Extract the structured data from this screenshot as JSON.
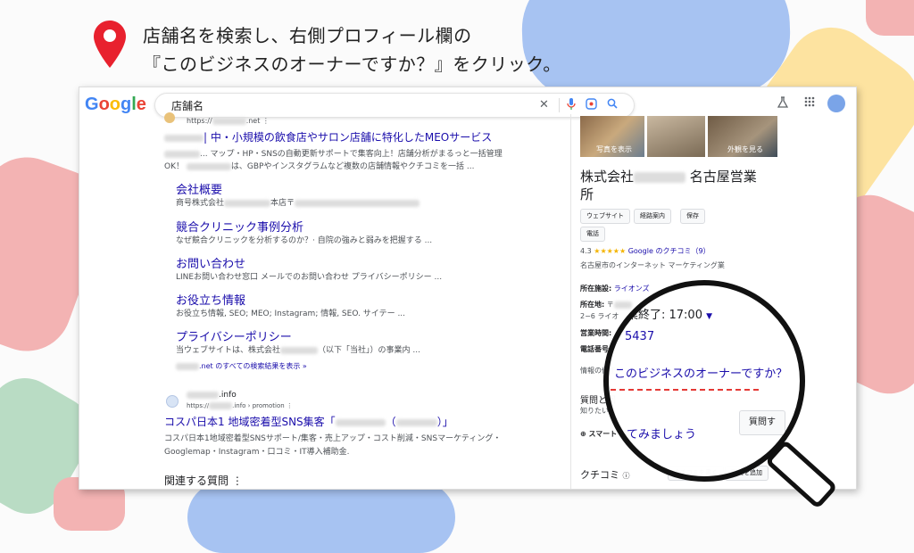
{
  "instruction": {
    "line1": "店舗名を検索し、右側プロフィール欄の",
    "line2": "『このビジネスのオーナーですか？』をクリック。"
  },
  "browser": {
    "logo": "Google",
    "search_value": "店舗名"
  },
  "results": {
    "first": {
      "url": "https://",
      "url_tail": ".net",
      "title": "| 中・小規模の飲食店やサロン店舗に特化したMEOサービス",
      "snippet1": "... マップ・HP・SNSの自動更新サポートで集客向上！店舗分析がまるっと一括管理",
      "snippet2_pre": "OK！",
      "snippet2": "は、GBPやインスタグラムなど複数の店舗情報やクチコミを一括 ..."
    },
    "sitelinks": [
      {
        "title": "会社概要",
        "desc": "商号株式会社",
        "desc2": "本店〒"
      },
      {
        "title": "競合クリニック事例分析",
        "desc": "なぜ競合クリニックを分析するのか？· 自院の強みと弱みを把握する ..."
      },
      {
        "title": "お問い合わせ",
        "desc": "LINEお問い合わせ窓口 メールでのお問い合わせ プライバシーポリシー ..."
      },
      {
        "title": "お役立ち情報",
        "desc": "お役立ち情報, SEO; MEO; Instagram; 情報, SEO. サイテー ..."
      },
      {
        "title": "プライバシーポリシー",
        "desc": "当ウェブサイトは、株式会社",
        "desc2": "（以下「当社」）の事業内 ..."
      }
    ],
    "more_results": ".net のすべての検索結果を表示 »",
    "second": {
      "site": ".info",
      "url": "https://",
      "url_tail": ".info › promotion",
      "title": "コスパ日本1 地域密着型SNS集客「",
      "title_end": "（",
      "title_close": "）」",
      "snippet1": "コスパ日本1地域密着型SNSサポート/集客・売上アップ・コスト削減・SNSマーケティング・",
      "snippet2": "Googlemap・Instagram・口コミ・IT導入補助金."
    },
    "related": "関連する質問"
  },
  "panel": {
    "photo_left_label": "写真を表示",
    "photo_right_label": "外観を見る",
    "name_prefix": "株式会社",
    "name_suffix": "名古屋営業",
    "name_line2": "所",
    "chips": [
      "ウェブサイト",
      "経路案内",
      "保存",
      "電話"
    ],
    "rating": "4.3",
    "stars": "★★★★★",
    "reviews": "Google のクチコミ（9）",
    "category": "名古屋市のインターネット マーケティング業",
    "facility_label": "所在施設:",
    "facility_value": "ライオンズ",
    "address_label": "所在地:",
    "address_value": "〒",
    "address_line2": "2−6 ライオ",
    "hours_label": "営業時間:",
    "phone_label": "電話番号:",
    "info_link": "情報の修正",
    "qa_label": "質問と回",
    "qa_link": "知りたいこ",
    "smart_label": "スマート",
    "reviews_label": "クチコミ",
    "review_btn": "クチコミを書く",
    "photo_btn": "写真を追加",
    "ask_btn": "質問す"
  },
  "lens": {
    "hours": "業終了: 17:00",
    "phone": "5437",
    "owner_link": "このビジネスのオーナーですか？",
    "ask_text": "てみましょう"
  },
  "colors": {
    "link": "#1a0dab",
    "pin": "#e8212e",
    "underline": "#e53935"
  }
}
